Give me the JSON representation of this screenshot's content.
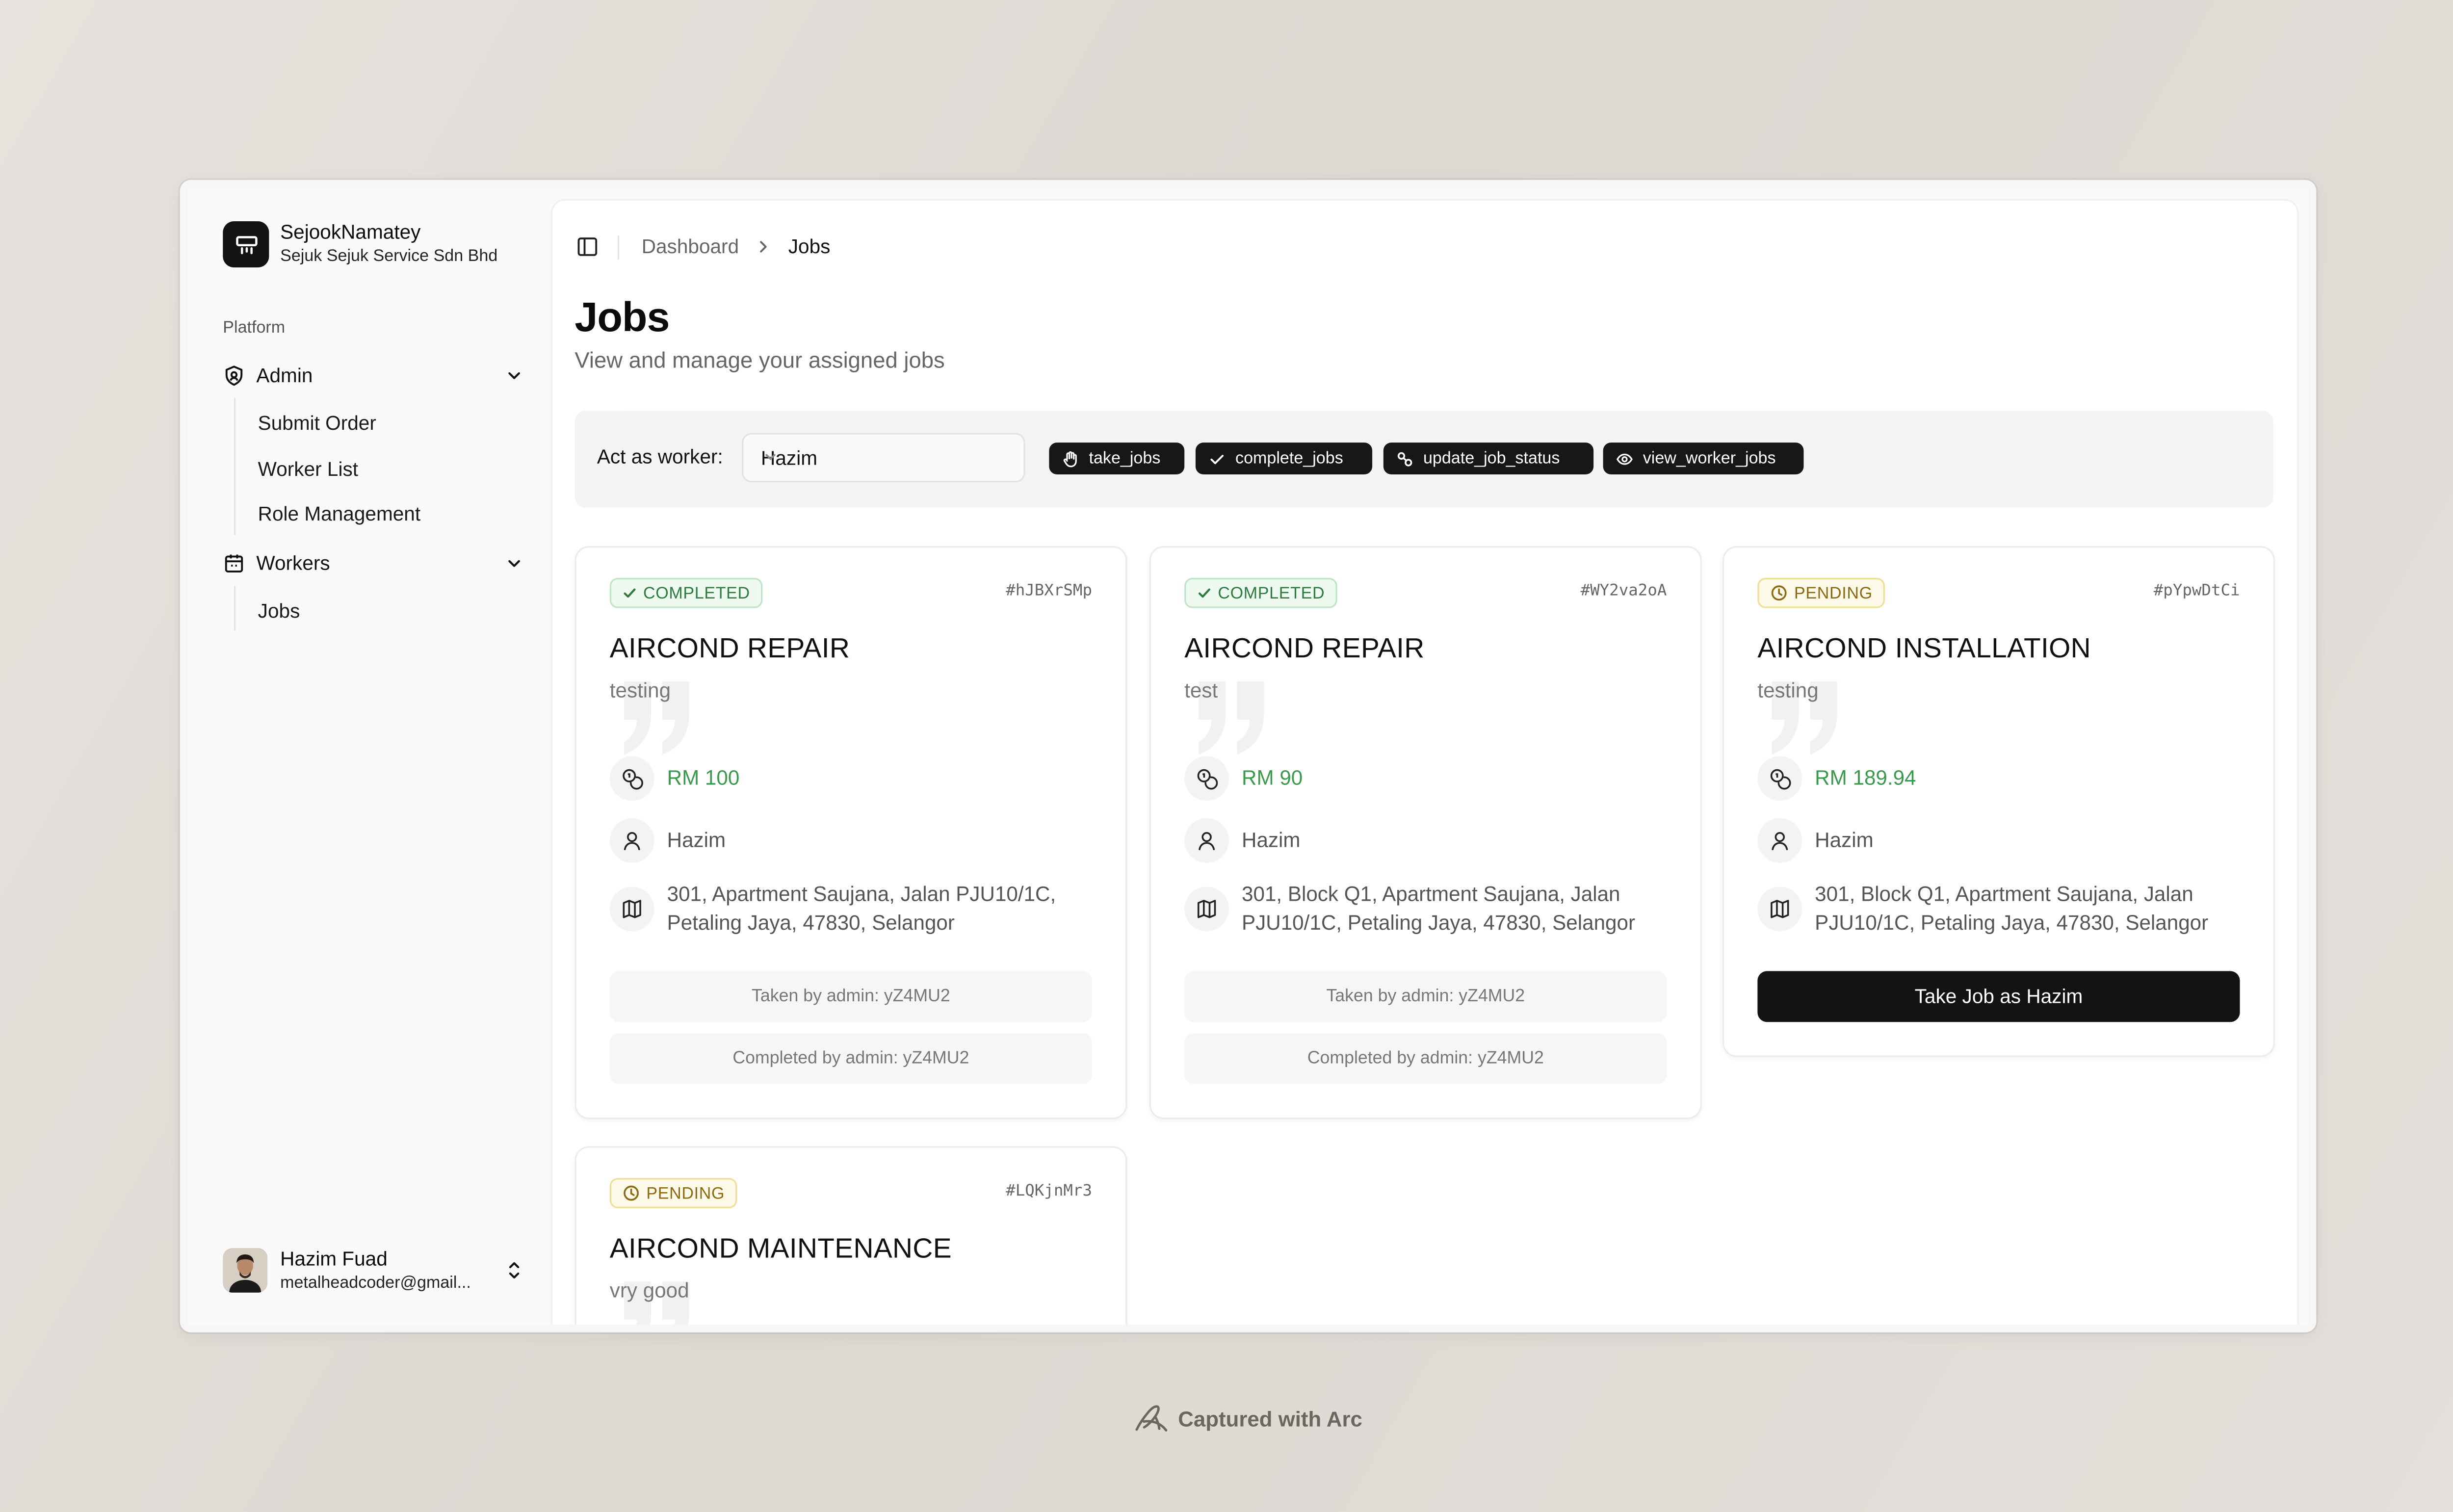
{
  "brand": {
    "name": "SejookNamatey",
    "company": "Sejuk Sejuk Service Sdn Bhd"
  },
  "sidebar": {
    "group_label": "Platform",
    "sections": [
      {
        "label": "Admin",
        "icon": "shield-icon",
        "items": [
          {
            "label": "Submit Order"
          },
          {
            "label": "Worker List"
          },
          {
            "label": "Role Management"
          }
        ]
      },
      {
        "label": "Workers",
        "icon": "calendar-icon",
        "items": [
          {
            "label": "Jobs"
          }
        ]
      }
    ],
    "user": {
      "name": "Hazim Fuad",
      "email": "metalheadcoder@gmail..."
    }
  },
  "breadcrumb": {
    "parent": "Dashboard",
    "current": "Jobs"
  },
  "page": {
    "title": "Jobs",
    "subtitle": "View and manage your assigned jobs"
  },
  "worker_bar": {
    "label": "Act as worker:",
    "selected_worker": "Hazim",
    "permissions": [
      {
        "label": "take_jobs",
        "icon": "hand-icon"
      },
      {
        "label": "complete_jobs",
        "icon": "check-icon"
      },
      {
        "label": "update_job_status",
        "icon": "link-icon"
      },
      {
        "label": "view_worker_jobs",
        "icon": "eye-icon"
      }
    ]
  },
  "jobs": [
    {
      "status": "COMPLETED",
      "id": "#hJBXrSMp",
      "title": "AIRCOND REPAIR",
      "description": "testing",
      "price": "RM 100",
      "worker": "Hazim",
      "address": "301, Apartment Saujana, Jalan PJU10/1C, Petaling Jaya, 47830, Selangor",
      "taken_by": "Taken by admin: yZ4MU2",
      "completed_by": "Completed by admin: yZ4MU2"
    },
    {
      "status": "COMPLETED",
      "id": "#WY2va2oA",
      "title": "AIRCOND REPAIR",
      "description": "test",
      "price": "RM 90",
      "worker": "Hazim",
      "address": "301, Block Q1, Apartment Saujana, Jalan PJU10/1C, Petaling Jaya, 47830, Selangor",
      "taken_by": "Taken by admin: yZ4MU2",
      "completed_by": "Completed by admin: yZ4MU2"
    },
    {
      "status": "PENDING",
      "id": "#pYpwDtCi",
      "title": "AIRCOND INSTALLATION",
      "description": "testing",
      "price": "RM 189.94",
      "worker": "Hazim",
      "address": "301, Block Q1, Apartment Saujana, Jalan PJU10/1C, Petaling Jaya, 47830, Selangor",
      "action_label": "Take Job as Hazim"
    },
    {
      "status": "PENDING",
      "id": "#LQKjnMr3",
      "title": "AIRCOND MAINTENANCE",
      "description": "vry good"
    }
  ],
  "footer": {
    "capture_label": "Captured with Arc"
  },
  "colors": {
    "completed": "#2f7a40",
    "pending": "#8a6a12",
    "price": "#3a9a4c",
    "primary_button": "#131313"
  }
}
